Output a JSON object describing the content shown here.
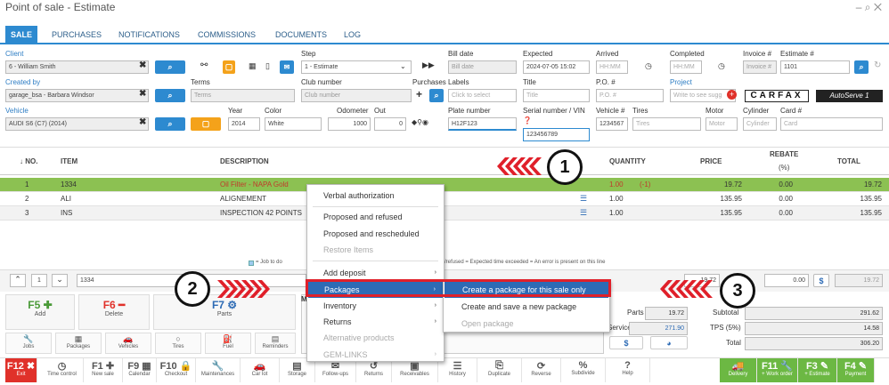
{
  "window": {
    "title": "Point of sale - Estimate",
    "controls": "– ⌕ ✕"
  },
  "tabs": [
    "SALE",
    "PURCHASES",
    "NOTIFICATIONS",
    "COMMISSIONS",
    "DOCUMENTS",
    "LOG"
  ],
  "form": {
    "client_label": "Client",
    "client_value": "6 - William Smith",
    "step_label": "Step",
    "step_value": "1 - Estimate",
    "bill_date_label": "Bill date",
    "bill_date_ph": "Bill date",
    "expected_label": "Expected",
    "expected_value": "2024-07-05 15:02",
    "arrived_label": "Arrived",
    "arrived_ph": "HH:MM",
    "completed_label": "Completed",
    "completed_ph": "HH:MM",
    "invoice_label": "Invoice #",
    "invoice_ph": "Invoice #",
    "estimate_label": "Estimate #",
    "estimate_value": "1101",
    "created_by_label": "Created by",
    "created_by_value": "garage_bsa - Barbara Windsor",
    "terms_label": "Terms",
    "terms_ph": "Terms",
    "club_label": "Club number",
    "club_ph": "Club number",
    "purchases_label": "Purchases",
    "labels_label": "Labels",
    "labels_ph": "Click to select",
    "title_label": "Title",
    "title_ph": "Title",
    "po_label": "P.O. #",
    "po_ph": "P.O. #",
    "project_label": "Project",
    "project_ph": "Write to see sugg",
    "carfax": "CARFAX",
    "autoserve": "AutoServe 1",
    "vehicle_label": "Vehicle",
    "vehicle_value": "AUDI S6 (C7) (2014)",
    "year_label": "Year",
    "year_value": "2014",
    "color_label": "Color",
    "color_value": "White",
    "odometer_label": "Odometer",
    "odometer_value": "1000",
    "out_label": "Out",
    "out_value": "0",
    "plate_label": "Plate number",
    "plate_value": "H12F123",
    "serial_label": "Serial number / VIN",
    "serial_value": "123456789",
    "vehicle_no_label": "Vehicle #",
    "vehicle_no_value": "1234567",
    "tires_label": "Tires",
    "tires_ph": "Tires",
    "motor_label": "Motor",
    "motor_ph": "Motor",
    "cylinder_label": "Cylinder",
    "cylinder_ph": "Cylinder",
    "card_label": "Card #",
    "card_ph": "Card"
  },
  "table": {
    "headers": {
      "no": "↓ NO.",
      "item": "ITEM",
      "description": "DESCRIPTION",
      "quantity": "QUANTITY",
      "price": "PRICE",
      "rebate": "REBATE",
      "rebate_unit": "(%)",
      "total": "TOTAL"
    },
    "rows": [
      {
        "no": "1",
        "item": "1334",
        "description": "Oil Filter - NAPA Gold",
        "quantity": "1.00",
        "qty_note": "(-1)",
        "price": "19.72",
        "rebate": "0.00",
        "total": "19.72"
      },
      {
        "no": "2",
        "item": "ALI",
        "description": "ALIGNEMENT",
        "quantity": "1.00",
        "qty_note": "",
        "price": "135.95",
        "rebate": "0.00",
        "total": "135.95"
      },
      {
        "no": "3",
        "item": "INS",
        "description": "INSPECTION 42 POINTS",
        "quantity": "1.00",
        "qty_note": "",
        "price": "135.95",
        "rebate": "0.00",
        "total": "135.95"
      }
    ]
  },
  "legend": {
    "left": "= Job to do",
    "right": "/refused  = Expected time exceeded  = An error is present on this line"
  },
  "line_editor": {
    "row_number": "1",
    "item": "1334",
    "qty": "19.72",
    "rebate": "0.00",
    "total": "19.72"
  },
  "context_menu": {
    "items": [
      {
        "label": "Verbal authorization",
        "disabled": false,
        "sub": false
      },
      {
        "label": "Proposed and refused",
        "disabled": false,
        "sub": false
      },
      {
        "label": "Proposed and rescheduled",
        "disabled": false,
        "sub": false
      },
      {
        "label": "Restore Items",
        "disabled": true,
        "sub": false
      },
      {
        "label": "Add deposit",
        "disabled": false,
        "sub": true
      },
      {
        "label": "Packages",
        "disabled": false,
        "sub": true
      },
      {
        "label": "Inventory",
        "disabled": false,
        "sub": true
      },
      {
        "label": "Returns",
        "disabled": false,
        "sub": true
      },
      {
        "label": "Alternative products",
        "disabled": true,
        "sub": false
      },
      {
        "label": "GEM-LINKS",
        "disabled": true,
        "sub": true
      }
    ],
    "submenu": [
      {
        "label": "Create a package for this sale only",
        "disabled": false
      },
      {
        "label": "Create and save a new package",
        "disabled": false
      },
      {
        "label": "Open package",
        "disabled": true
      }
    ]
  },
  "fkeys": [
    {
      "key": "F5",
      "label": "Add"
    },
    {
      "key": "F6",
      "label": "Delete"
    },
    {
      "key": "F7",
      "label": "Parts"
    }
  ],
  "quick": [
    "Jobs",
    "Packages",
    "Vehicles",
    "Tires",
    "Fuel",
    "Reminders"
  ],
  "summary": {
    "parts_label": "Parts",
    "parts_value": "19.72",
    "service_label": "Service(s)",
    "service_value": "271.90",
    "subtotal_label": "Subtotal",
    "subtotal_value": "291.62",
    "tps_label": "TPS (5%)",
    "tps_value": "14.58",
    "total_label": "Total",
    "total_value": "306.20"
  },
  "bottom_bar": [
    {
      "key": "F12 ✖",
      "label": "Exit",
      "style": "red"
    },
    {
      "key": "◷",
      "label": "Time control",
      "style": ""
    },
    {
      "key": "F1 ✚",
      "label": "New sale",
      "style": ""
    },
    {
      "key": "F9 ▦",
      "label": "Calendar",
      "style": ""
    },
    {
      "key": "F10 🔒",
      "label": "Checkout",
      "style": ""
    },
    {
      "key": "🔧",
      "label": "Maintenances",
      "style": ""
    },
    {
      "key": "🚗",
      "label": "Car lot",
      "style": ""
    },
    {
      "key": "▤",
      "label": "Storage",
      "style": ""
    },
    {
      "key": "✉",
      "label": "Follow-ups",
      "style": ""
    },
    {
      "key": "↺",
      "label": "Returns",
      "style": ""
    },
    {
      "key": "▣",
      "label": "Receivables",
      "style": ""
    },
    {
      "key": "☰",
      "label": "History",
      "style": ""
    },
    {
      "key": "⎘",
      "label": "Duplicate",
      "style": ""
    },
    {
      "key": "⟳",
      "label": "Reverse",
      "style": ""
    },
    {
      "key": "%",
      "label": "Subdivide",
      "style": ""
    },
    {
      "key": "?",
      "label": "Help",
      "style": ""
    },
    {
      "key": "🚚",
      "label": "Delivery",
      "style": "green"
    },
    {
      "key": "F11 🔧",
      "label": "+ Work order",
      "style": "green"
    },
    {
      "key": "F3 ✎",
      "label": "+ Estimate",
      "style": "green"
    },
    {
      "key": "F4 ✎",
      "label": "Payment",
      "style": "green"
    }
  ],
  "annotations": [
    "1",
    "2",
    "3"
  ],
  "colors": {
    "accent": "#2d8ad0",
    "selected_row": "#8cc152",
    "orange_button": "#f4a21a",
    "menu_highlight": "#2d6bb5",
    "marker_red": "#e0202a",
    "green_button": "#6cb843",
    "red_button": "#e0312a"
  }
}
